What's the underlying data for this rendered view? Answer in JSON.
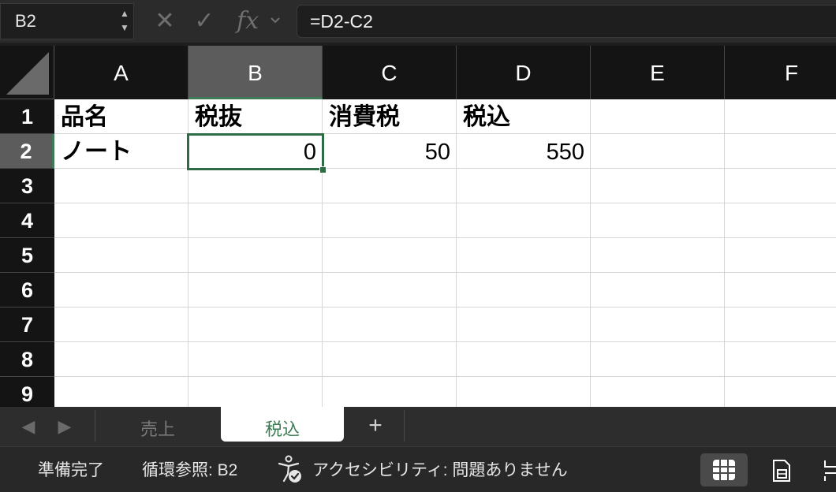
{
  "formula_bar": {
    "name_box": "B2",
    "stepper_up": "▲",
    "stepper_down": "▼",
    "cancel_symbol": "✕",
    "confirm_symbol": "✓",
    "fx_label": "fx",
    "formula": "=D2-C2"
  },
  "columns": [
    "A",
    "B",
    "C",
    "D",
    "E",
    "F"
  ],
  "selected_column": "B",
  "rows": [
    "1",
    "2",
    "3",
    "4",
    "5",
    "6",
    "7",
    "8",
    "9"
  ],
  "selected_row": "2",
  "cells": {
    "A1": "品名",
    "B1": "税抜",
    "C1": "消費税",
    "D1": "税込",
    "A2": "ノート",
    "B2": "0",
    "C2": "50",
    "D2": "550"
  },
  "sheet_tabs": [
    {
      "label": "売上",
      "active": false
    },
    {
      "label": "税込",
      "active": true
    }
  ],
  "add_sheet_label": "+",
  "status_bar": {
    "ready": "準備完了",
    "circular_reference": "循環参照: B2",
    "accessibility": "アクセシビリティ: 問題ありません"
  },
  "colors": {
    "accent": "#3e7b54",
    "header_bg": "#141414",
    "selected_header_bg": "#5c5c5c",
    "chrome_bg": "#2b2b2b"
  }
}
